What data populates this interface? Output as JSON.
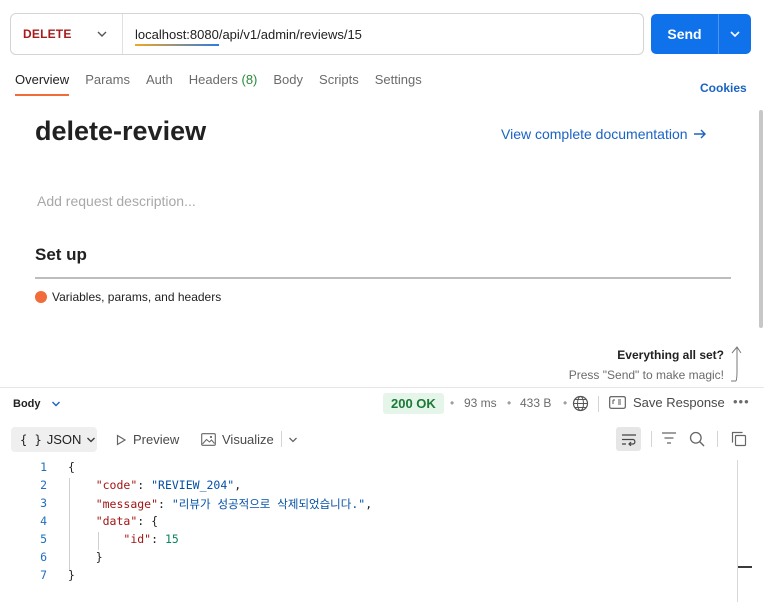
{
  "request": {
    "method": "DELETE",
    "url_host": "localhost:8080",
    "url_path": "/api/v1/admin/reviews/15",
    "send_label": "Send"
  },
  "tabs": [
    {
      "label": "Overview",
      "count": ""
    },
    {
      "label": "Params",
      "count": ""
    },
    {
      "label": "Auth",
      "count": ""
    },
    {
      "label": "Headers",
      "count": "(8)"
    },
    {
      "label": "Body",
      "count": ""
    },
    {
      "label": "Scripts",
      "count": ""
    },
    {
      "label": "Settings",
      "count": ""
    }
  ],
  "cookies_label": "Cookies",
  "overview": {
    "title": "delete-review",
    "docs_link": "View complete documentation",
    "description_placeholder": "Add request description...",
    "setup_heading": "Set up",
    "setup_item": "Variables, params, and headers",
    "allset_title": "Everything all set?",
    "allset_sub": "Press \"Send\" to make magic!"
  },
  "response": {
    "body_label": "Body",
    "status": "200 OK",
    "time": "93 ms",
    "size": "433 B",
    "save_label": "Save Response",
    "format_label": "JSON",
    "preview_label": "Preview",
    "visualize_label": "Visualize"
  },
  "code": {
    "line_numbers": [
      "1",
      "2",
      "3",
      "4",
      "5",
      "6",
      "7"
    ],
    "code_key": "\"code\"",
    "code_value": "\"REVIEW_204\"",
    "message_key": "\"message\"",
    "message_value": "\"리뷰가 성공적으로 삭제되었습니다.\"",
    "data_key": "\"data\"",
    "id_key": "\"id\"",
    "id_value": "15"
  },
  "colors": {
    "accent": "#f26b3a",
    "send": "#0f72ea",
    "method": "#a61c1c",
    "link": "#1a63c4",
    "status_ok": "#1b7a35"
  },
  "icons": [
    "chevron-down-icon",
    "arrow-right-icon",
    "globe-icon",
    "save-response-icon",
    "more-icon",
    "play-icon",
    "image-icon",
    "wrap-icon",
    "filter-icon",
    "search-icon",
    "copy-icon",
    "up-arrow-icon"
  ]
}
